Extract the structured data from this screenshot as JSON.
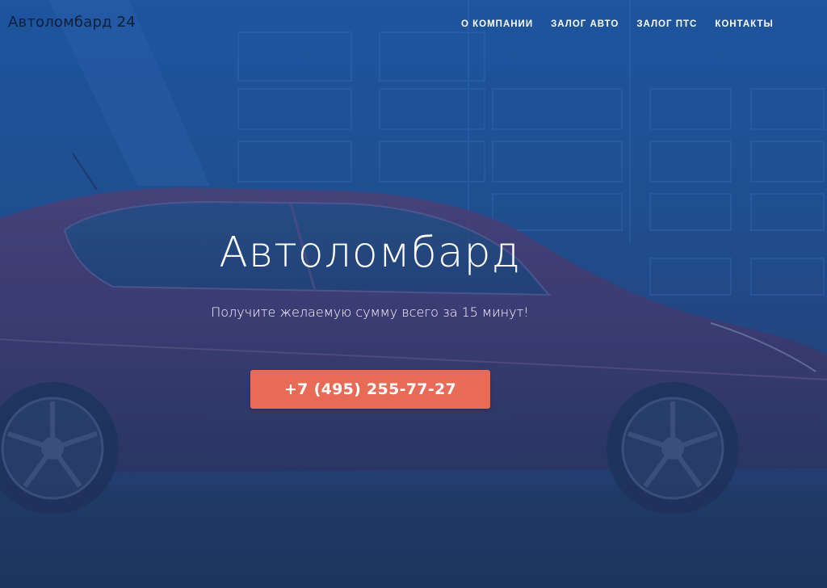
{
  "header": {
    "brand": "Автоломбард 24",
    "nav": [
      {
        "label": "О КОМПАНИИ"
      },
      {
        "label": "ЗАЛОГ АВТО"
      },
      {
        "label": "ЗАЛОГ ПТС"
      },
      {
        "label": "КОНТАКТЫ"
      }
    ]
  },
  "hero": {
    "title": "Автоломбард",
    "subtitle": "Получите желаемую сумму всего за 15 минут!",
    "cta_label": "+7 (495) 255-77-27"
  },
  "colors": {
    "overlay_top": "#1c58a3",
    "overlay_bottom": "#1f2f52",
    "cta": "#e86b55",
    "brand_text": "#0d1f3a"
  }
}
